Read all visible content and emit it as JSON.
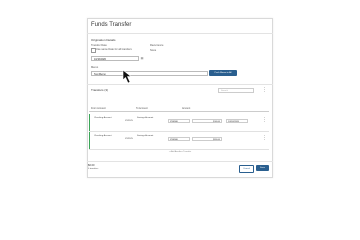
{
  "dialog": {
    "title": "Funds Transfer"
  },
  "origination": {
    "heading": "Origination Details",
    "transfer_date_label": "Transfer Date",
    "same_date_label": "Use same Date for all transfers",
    "recurrence_label": "Recurrence",
    "recurrence_value": "None",
    "date_value": "10/16/2020",
    "memo_label": "Memo",
    "memo_value": "Test Memo",
    "push_button": "Push Memo to All"
  },
  "transfers": {
    "heading": "Transfers (3)",
    "search_placeholder": "Search",
    "columns": [
      "From Account",
      "To Account",
      "Amount"
    ],
    "rows": [
      {
        "from_name": "Checking Account",
        "from_num": "XX2525",
        "to_name": "Savings Account",
        "to_num": "XX4580",
        "amount": "$10.00",
        "date": "10/16/2020"
      },
      {
        "from_name": "Checking Account",
        "from_num": "XX2525",
        "to_name": "Savings Account",
        "to_num": "XX4580",
        "amount": "$20.00",
        "date": "10/16/2020"
      }
    ],
    "add_more": "+ Add Another Transfer"
  },
  "footer": {
    "total_amount": "$0.00",
    "total_label": "0 transfers",
    "cancel_button": "Cancel",
    "save_button": "Save"
  }
}
